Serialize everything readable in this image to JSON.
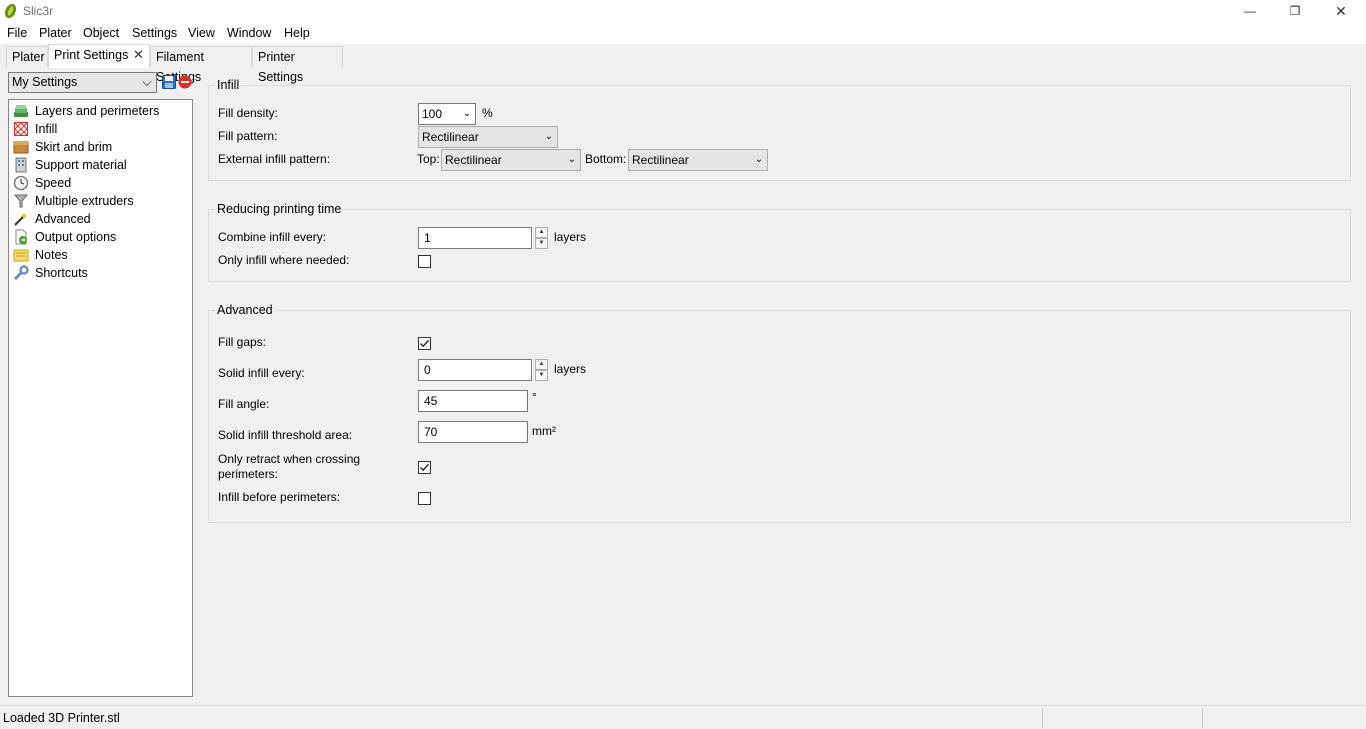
{
  "window": {
    "title": "Slic3r",
    "minimize_glyph": "—",
    "restore_glyph": "❐",
    "close_glyph": "✕"
  },
  "menu": [
    "File",
    "Plater",
    "Object",
    "Settings",
    "View",
    "Window",
    "Help"
  ],
  "tabs": {
    "plater": "Plater",
    "print_settings": "Print Settings",
    "filament_settings": "Filament Settings",
    "printer_settings": "Printer Settings",
    "close_glyph": "✕"
  },
  "preset": {
    "selected": "My Settings",
    "arrow": "⌵"
  },
  "pages": [
    {
      "label": "Layers and perimeters",
      "icon": "layers-icon"
    },
    {
      "label": "Infill",
      "icon": "infill-icon"
    },
    {
      "label": "Skirt and brim",
      "icon": "box-icon"
    },
    {
      "label": "Support material",
      "icon": "building-icon"
    },
    {
      "label": "Speed",
      "icon": "time-icon"
    },
    {
      "label": "Multiple extruders",
      "icon": "funnel-icon"
    },
    {
      "label": "Advanced",
      "icon": "wand-icon"
    },
    {
      "label": "Output options",
      "icon": "page-go-icon"
    },
    {
      "label": "Notes",
      "icon": "note-icon"
    },
    {
      "label": "Shortcuts",
      "icon": "wrench-icon"
    }
  ],
  "infill": {
    "title": "Infill",
    "fill_density_label": "Fill density:",
    "fill_density_value": "100",
    "fill_density_unit": "%",
    "fill_pattern_label": "Fill pattern:",
    "fill_pattern_value": "Rectilinear",
    "external_label": "External infill pattern:",
    "top_label": "Top:",
    "top_value": "Rectilinear",
    "bottom_label": "Bottom:",
    "bottom_value": "Rectilinear"
  },
  "reducing": {
    "title": "Reducing printing time",
    "combine_label": "Combine infill every:",
    "combine_value": "1",
    "combine_unit": "layers",
    "only_infill_label": "Only infill where needed:",
    "only_infill_checked": false
  },
  "advanced": {
    "title": "Advanced",
    "fill_gaps_label": "Fill gaps:",
    "fill_gaps_checked": true,
    "solid_every_label": "Solid infill every:",
    "solid_every_value": "0",
    "solid_every_unit": "layers",
    "fill_angle_label": "Fill angle:",
    "fill_angle_value": "45",
    "fill_angle_unit": "°",
    "threshold_label": "Solid infill threshold area:",
    "threshold_value": "70",
    "threshold_unit": "mm²",
    "only_retract_label_1": "Only retract when crossing",
    "only_retract_label_2": "perimeters:",
    "only_retract_checked": true,
    "infill_before_label": "Infill before perimeters:",
    "infill_before_checked": false
  },
  "status": {
    "text": "Loaded 3D Printer.stl"
  },
  "colors": {
    "accent_green": "#4a8a2c",
    "delete_red": "#d9302a",
    "save_blue": "#2f6fbf"
  }
}
